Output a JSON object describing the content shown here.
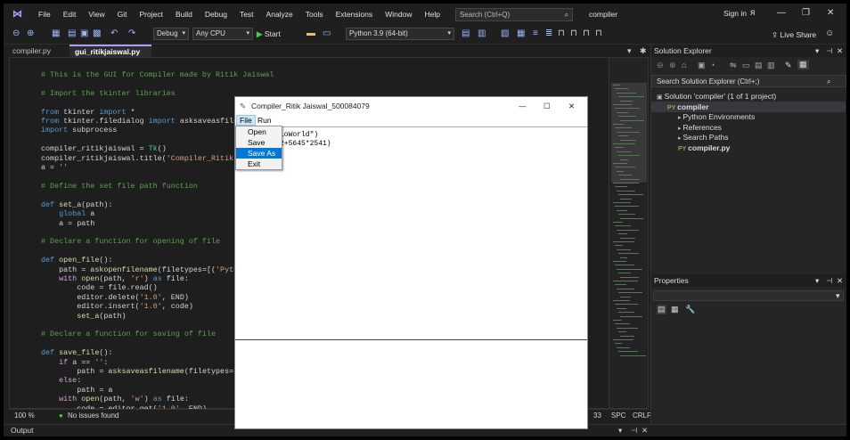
{
  "menubar": {
    "logo": "VS",
    "items": [
      "File",
      "Edit",
      "View",
      "Git",
      "Project",
      "Build",
      "Debug",
      "Test",
      "Analyze",
      "Tools",
      "Extensions",
      "Window",
      "Help"
    ],
    "search_placeholder": "Search (Ctrl+Q)",
    "solution_title": "compiler",
    "sign_in": "Sign in"
  },
  "toolbar": {
    "config": "Debug",
    "platform": "Any CPU",
    "start": "Start",
    "env": "Python 3.9 (64-bit)",
    "live_share": "Live Share"
  },
  "tabs": [
    {
      "label": "compiler.py"
    },
    {
      "label": "gui_ritikjaiswal.py"
    }
  ],
  "editor": {
    "lines": [
      [
        [
          "cm",
          "# This is the GUI for Compiler made by Ritik Jaiswal"
        ]
      ],
      [
        [
          "",
          ""
        ]
      ],
      [
        [
          "cm",
          "# Import the tkinter libraries"
        ]
      ],
      [
        [
          "",
          ""
        ]
      ],
      [
        [
          "kw",
          "from"
        ],
        [
          "",
          " tkinter "
        ],
        [
          "kw",
          "import"
        ],
        [
          "",
          " *"
        ]
      ],
      [
        [
          "kw",
          "from"
        ],
        [
          "",
          " tkinter.filedialog "
        ],
        [
          "kw",
          "import"
        ],
        [
          "",
          " asksaveasfilenam"
        ]
      ],
      [
        [
          "kw",
          "import"
        ],
        [
          "",
          " subprocess"
        ]
      ],
      [
        [
          "",
          ""
        ]
      ],
      [
        [
          "",
          "compiler_ritikjaiswal = "
        ],
        [
          "cl",
          "Tk"
        ],
        [
          "",
          "()"
        ]
      ],
      [
        [
          "",
          "compiler_ritikjaiswal.title("
        ],
        [
          "st",
          "'Compiler_Ritik Jai"
        ]
      ],
      [
        [
          "",
          "a = "
        ],
        [
          "st",
          "''"
        ]
      ],
      [
        [
          "",
          ""
        ]
      ],
      [
        [
          "cm",
          "# Define the set file path function"
        ]
      ],
      [
        [
          "",
          ""
        ]
      ],
      [
        [
          "kw",
          "def"
        ],
        [
          "",
          " "
        ],
        [
          "fn",
          "set_a"
        ],
        [
          "",
          "(path):"
        ]
      ],
      [
        [
          "",
          "    "
        ],
        [
          "kw",
          "global"
        ],
        [
          "",
          " a"
        ]
      ],
      [
        [
          "",
          "    a = path"
        ]
      ],
      [
        [
          "",
          ""
        ]
      ],
      [
        [
          "cm",
          "# Declare a function for opening of file"
        ]
      ],
      [
        [
          "",
          ""
        ]
      ],
      [
        [
          "kw",
          "def"
        ],
        [
          "",
          " "
        ],
        [
          "fn",
          "open_file"
        ],
        [
          "",
          "():"
        ]
      ],
      [
        [
          "",
          "    path = "
        ],
        [
          "fn",
          "askopenfilename"
        ],
        [
          "",
          "(filetypes=[("
        ],
        [
          "st",
          "'Python"
        ]
      ],
      [
        [
          "",
          "    "
        ],
        [
          "pk",
          "with"
        ],
        [
          "",
          " "
        ],
        [
          "fn",
          "open"
        ],
        [
          "",
          "(path, "
        ],
        [
          "st",
          "'r'"
        ],
        [
          "",
          ") "
        ],
        [
          "kw",
          "as"
        ],
        [
          "",
          " file:"
        ]
      ],
      [
        [
          "",
          "        code = file.read()"
        ]
      ],
      [
        [
          "",
          "        editor.delete("
        ],
        [
          "st",
          "'1.0'"
        ],
        [
          "",
          ", END)"
        ]
      ],
      [
        [
          "",
          "        editor.insert("
        ],
        [
          "st",
          "'1.0'"
        ],
        [
          "",
          ", code)"
        ]
      ],
      [
        [
          "",
          "        "
        ],
        [
          "fn",
          "set_a"
        ],
        [
          "",
          "(path)"
        ]
      ],
      [
        [
          "",
          ""
        ]
      ],
      [
        [
          "cm",
          "# Declare a function for saving of file"
        ]
      ],
      [
        [
          "",
          ""
        ]
      ],
      [
        [
          "kw",
          "def"
        ],
        [
          "",
          " "
        ],
        [
          "fn",
          "save_file"
        ],
        [
          "",
          "():"
        ]
      ],
      [
        [
          "",
          "    "
        ],
        [
          "pk",
          "if"
        ],
        [
          "",
          " a == "
        ],
        [
          "st",
          "''"
        ],
        [
          "",
          ":"
        ]
      ],
      [
        [
          "",
          "        path = "
        ],
        [
          "fn",
          "asksaveasfilename"
        ],
        [
          "",
          "(filetypes=[("
        ],
        [
          "st",
          "'P"
        ]
      ],
      [
        [
          "",
          "    "
        ],
        [
          "pk",
          "else"
        ],
        [
          "",
          ":"
        ]
      ],
      [
        [
          "",
          "        path = a"
        ]
      ],
      [
        [
          "",
          "    "
        ],
        [
          "pk",
          "with"
        ],
        [
          "",
          " "
        ],
        [
          "fn",
          "open"
        ],
        [
          "",
          "(path, "
        ],
        [
          "st",
          "'w'"
        ],
        [
          "",
          ") "
        ],
        [
          "kw",
          "as"
        ],
        [
          "",
          " file:"
        ]
      ],
      [
        [
          "",
          "        code = editor.get("
        ],
        [
          "st",
          "'1.0'"
        ],
        [
          "",
          ", END)"
        ]
      ]
    ]
  },
  "status": {
    "zoom": "100 %",
    "issues": "No issues found",
    "col": "33",
    "spc": "SPC",
    "crlf": "CRLF"
  },
  "output_label": "Output",
  "solution_explorer": {
    "title": "Solution Explorer",
    "search_placeholder": "Search Solution Explorer (Ctrl+;)",
    "items": [
      {
        "label": "Solution 'compiler' (1 of 1 project)",
        "indent": 0,
        "bold": false
      },
      {
        "label": "compiler",
        "indent": 1,
        "bold": true
      },
      {
        "label": "Python Environments",
        "indent": 2,
        "bold": false
      },
      {
        "label": "References",
        "indent": 2,
        "bold": false
      },
      {
        "label": "Search Paths",
        "indent": 2,
        "bold": false
      },
      {
        "label": "compiler.py",
        "indent": 2,
        "bold": true
      }
    ]
  },
  "properties": {
    "title": "Properties"
  },
  "tk_window": {
    "title": "Compiler_Ritik Jaiswal_500084079",
    "menu": [
      "File",
      "Run"
    ],
    "editor_text": "loWorld\")\n2+5645*2541)",
    "dropdown": [
      "Open",
      "Save",
      "Save As",
      "Exit"
    ],
    "highlighted": "Save As"
  },
  "colors": {
    "accent": "#b09cff",
    "highlight": "#0078d7"
  }
}
